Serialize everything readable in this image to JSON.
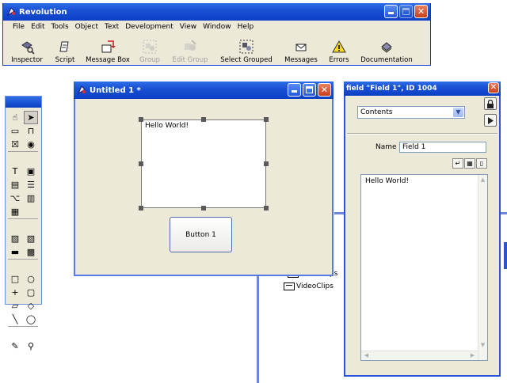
{
  "app": {
    "title": "Revolution",
    "menu": [
      "File",
      "Edit",
      "Tools",
      "Object",
      "Text",
      "Development",
      "View",
      "Window",
      "Help"
    ],
    "toolbar": [
      {
        "label": "Inspector",
        "icon": "inspector-icon",
        "enabled": true
      },
      {
        "label": "Script",
        "icon": "script-icon",
        "enabled": true
      },
      {
        "label": "Message Box",
        "icon": "message-box-icon",
        "enabled": true
      },
      {
        "label": "Group",
        "icon": "group-icon",
        "enabled": false
      },
      {
        "label": "Edit Group",
        "icon": "edit-group-icon",
        "enabled": false
      },
      {
        "label": "Select Grouped",
        "icon": "select-grouped-icon",
        "enabled": true
      },
      {
        "label": "Messages",
        "icon": "messages-icon",
        "enabled": true
      },
      {
        "label": "Errors",
        "icon": "errors-icon",
        "enabled": true
      },
      {
        "label": "Documentation",
        "icon": "documentation-icon",
        "enabled": true
      }
    ]
  },
  "stack": {
    "title": "Untitled 1 *",
    "field_text": "Hello World!",
    "button_label": "Button 1"
  },
  "background_stack": {
    "items": [
      "AudioClips",
      "VideoClips"
    ]
  },
  "inspector": {
    "title": "field \"Field 1\", ID 1004",
    "pane": "Contents",
    "name_label": "Name",
    "name_value": "Field 1",
    "content": "Hello World!"
  },
  "colors": {
    "titlebar": "#0b3fc5",
    "window_bg": "#ece9d8",
    "close": "#c6401c"
  }
}
